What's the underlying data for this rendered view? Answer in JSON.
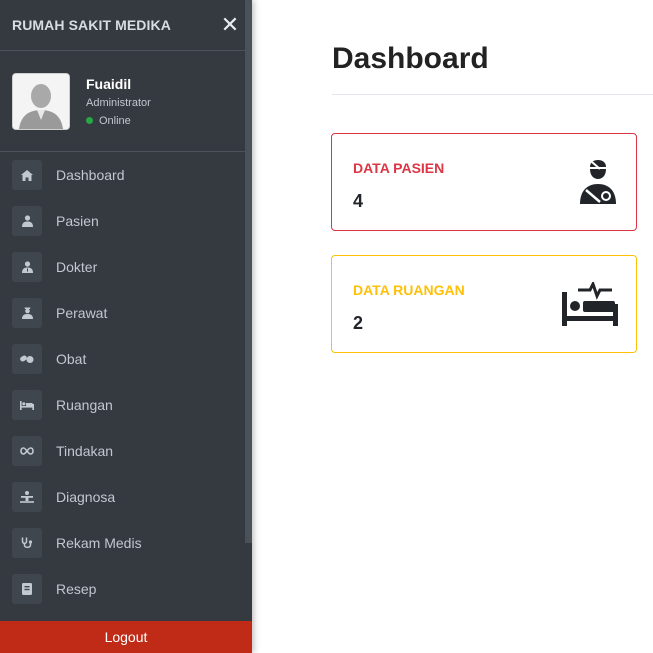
{
  "sidebar": {
    "brand": "RUMAH SAKIT MEDIKA",
    "close": "✕",
    "user": {
      "name": "Fuaidil",
      "role": "Administrator",
      "status": "Online"
    },
    "items": [
      {
        "label": "Dashboard",
        "icon": "home-icon"
      },
      {
        "label": "Pasien",
        "icon": "user-injured-icon"
      },
      {
        "label": "Dokter",
        "icon": "user-md-icon"
      },
      {
        "label": "Perawat",
        "icon": "user-nurse-icon"
      },
      {
        "label": "Obat",
        "icon": "capsules-icon"
      },
      {
        "label": "Ruangan",
        "icon": "procedures-icon"
      },
      {
        "label": "Tindakan",
        "icon": "infinity-icon"
      },
      {
        "label": "Diagnosa",
        "icon": "diagnoses-icon"
      },
      {
        "label": "Rekam Medis",
        "icon": "stethoscope-icon"
      },
      {
        "label": "Resep",
        "icon": "book-medical-icon"
      }
    ],
    "logout": "Logout"
  },
  "main": {
    "title": "Dashboard",
    "cards": [
      {
        "title": "DATA PASIEN",
        "value": "4",
        "color": "#dc3545",
        "icon": "user-injured-icon"
      },
      {
        "title": "DATA RUANGAN",
        "value": "2",
        "color": "#ffc107",
        "icon": "procedures-icon"
      }
    ]
  },
  "colors": {
    "sidebar_bg": "#343a40",
    "logout_bg": "#bf2b16",
    "status_online": "#28a745"
  }
}
